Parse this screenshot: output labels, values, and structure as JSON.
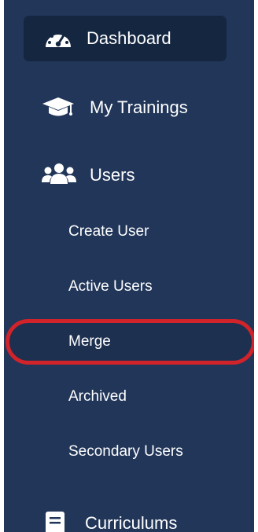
{
  "sidebar": {
    "items": [
      {
        "label": "Dashboard",
        "icon": "tachometer-icon",
        "active": true
      },
      {
        "label": "My Trainings",
        "icon": "graduation-cap-icon"
      },
      {
        "label": "Users",
        "icon": "users-icon"
      },
      {
        "label": "Curriculums",
        "icon": "document-icon"
      }
    ],
    "user_subitems": [
      {
        "label": "Create User"
      },
      {
        "label": "Active Users"
      },
      {
        "label": "Merge",
        "highlighted": true
      },
      {
        "label": "Archived"
      },
      {
        "label": "Secondary Users"
      }
    ]
  },
  "colors": {
    "sidebar_bg": "#213659",
    "active_bg": "#152641",
    "text": "#ffffff",
    "highlight_ring": "#d1232a"
  }
}
